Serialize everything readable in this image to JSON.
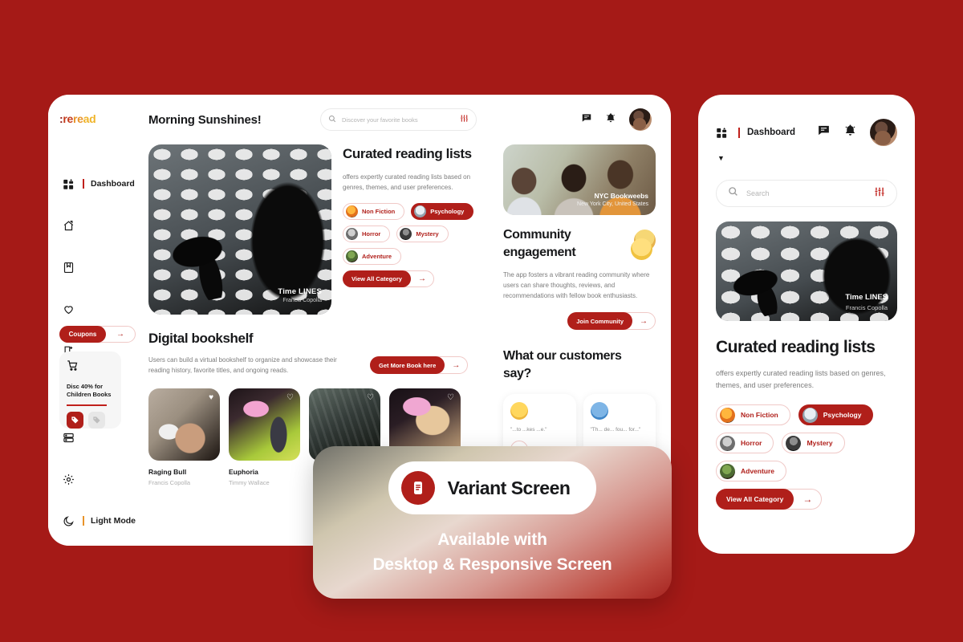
{
  "brand": {
    "logo_part1": ":",
    "logo_part2": "re",
    "logo_part3": "re",
    "logo_part4": "ad",
    "accent": "#B01F1A",
    "background": "#A51A17"
  },
  "sidebar": {
    "items": [
      {
        "label": "Dashboard",
        "icon": "grid-icon"
      },
      {
        "label": "",
        "icon": "home-icon"
      },
      {
        "label": "",
        "icon": "book-icon"
      },
      {
        "label": "",
        "icon": "heart-icon"
      },
      {
        "label": "",
        "icon": "bookmark-icon"
      }
    ],
    "coupons_label": "Coupons",
    "promo": {
      "title_line1": "Disc 40% for",
      "title_line2": "Children Books",
      "icon": "cart-icon"
    },
    "bottom_items": [
      {
        "label": "",
        "icon": "server-icon"
      },
      {
        "label": "",
        "icon": "gear-icon"
      },
      {
        "label": "Light Mode",
        "icon": "moon-icon"
      }
    ]
  },
  "topbar": {
    "greeting": "Morning Sunshines!",
    "search_placeholder": "Discover your favorite books",
    "search_value": "",
    "icons": [
      "message-icon",
      "bell-icon",
      "filter-icon"
    ]
  },
  "hero": {
    "title": "Time LINES",
    "author": "Francis Copolla"
  },
  "curated": {
    "title": "Curated reading lists",
    "body": "offers expertly curated reading lists based on genres, themes, and user preferences.",
    "chips": [
      {
        "label": "Non Fiction",
        "style": "outline",
        "avatar": "av-nf"
      },
      {
        "label": "Psychology",
        "style": "solid",
        "avatar": "av-psy"
      },
      {
        "label": "Horror",
        "style": "outline",
        "avatar": "av-hor"
      },
      {
        "label": "Mystery",
        "style": "outline",
        "avatar": "av-mys"
      },
      {
        "label": "Adventure",
        "style": "outline",
        "avatar": "av-adv"
      }
    ],
    "view_all_label": "View All Category"
  },
  "bookshelf": {
    "title": "Digital bookshelf",
    "body": "Users can build a virtual bookshelf to organize and showcase their reading history, favorite titles, and ongoing reads.",
    "cta_label": "Get More Book here",
    "books": [
      {
        "title": "Raging Bull",
        "author": "Francis Copolla",
        "thumb": "b1"
      },
      {
        "title": "Euphoria",
        "author": "Timmy Wallace",
        "thumb": "b2"
      },
      {
        "title": "",
        "author": "",
        "thumb": "b3"
      },
      {
        "title": "",
        "author": "",
        "thumb": "b4"
      }
    ]
  },
  "community": {
    "photo_title": "NYC Bookweebs",
    "photo_subtitle": "New York City, United States",
    "title": "Community engagement",
    "body": "The app fosters a vibrant reading community where users can share thoughts, reviews, and recommendations with fellow book enthusiasts.",
    "cta_label": "Join Community"
  },
  "testimonials": {
    "title": "What our customers say?",
    "items": [
      {
        "quote": "\"...to ...kes ...e.\"",
        "avatar": "y"
      },
      {
        "quote": "\"Th... de... fou... for...\"",
        "avatar": "b"
      }
    ]
  },
  "overlay": {
    "badge_icon": "document-icon",
    "pill_label": "Variant Screen",
    "line1": "Available with",
    "line2": "Desktop & Responsive Screen"
  },
  "mobile": {
    "dashboard_label": "Dashboard",
    "search_placeholder": "Search",
    "search_value": "",
    "hero": {
      "title": "Time LINES",
      "author": "Francis Copolla"
    },
    "title": "Curated reading lists",
    "body": "offers expertly curated reading lists based on genres, themes, and user preferences.",
    "chips": [
      {
        "label": "Non Fiction",
        "style": "outline",
        "avatar": "av-nf"
      },
      {
        "label": "Psychology",
        "style": "solid",
        "avatar": "av-psy"
      },
      {
        "label": "Horror",
        "style": "outline",
        "avatar": "av-hor"
      },
      {
        "label": "Mystery",
        "style": "outline",
        "avatar": "av-mys"
      },
      {
        "label": "Adventure",
        "style": "outline",
        "avatar": "av-adv"
      }
    ],
    "view_all_label": "View All Category"
  }
}
